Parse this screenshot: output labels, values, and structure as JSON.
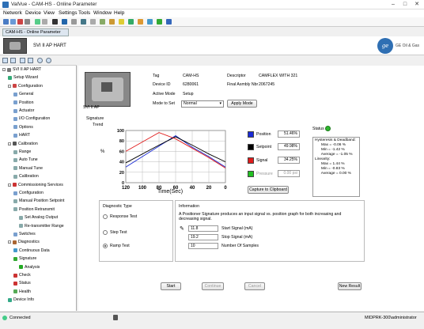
{
  "window": {
    "title": "ValVue - CAM-HS - Online Parameter",
    "controls": [
      "–",
      "□",
      "✕"
    ]
  },
  "menu": [
    "Network",
    "Device",
    "View",
    "Settings",
    "Tools",
    "Window",
    "Help"
  ],
  "doc_tab": "CAM-HS - Online Parameter",
  "header": {
    "device_name": "SVI II AP HART",
    "logo_text": "ge",
    "brand": "GE Oil & Gas"
  },
  "tree": {
    "items": [
      {
        "label": "SVI II AP HART",
        "level": 0,
        "icon": "device-icon"
      },
      {
        "label": "Setup Wizard",
        "level": 1,
        "icon": "wizard-icon"
      },
      {
        "label": "Configuration",
        "level": 1,
        "icon": "config-icon"
      },
      {
        "label": "General",
        "level": 2,
        "icon": "page-icon"
      },
      {
        "label": "Position",
        "level": 2,
        "icon": "page-icon"
      },
      {
        "label": "Actuator",
        "level": 2,
        "icon": "page-icon"
      },
      {
        "label": "I/O Configuration",
        "level": 2,
        "icon": "page-icon"
      },
      {
        "label": "Options",
        "level": 2,
        "icon": "page-icon"
      },
      {
        "label": "HART",
        "level": 2,
        "icon": "page-icon"
      },
      {
        "label": "Calibration",
        "level": 1,
        "icon": "calibration-icon"
      },
      {
        "label": "Range",
        "level": 2,
        "icon": "tool-icon"
      },
      {
        "label": "Auto Tune",
        "level": 2,
        "icon": "tool-icon"
      },
      {
        "label": "Manual Tune",
        "level": 2,
        "icon": "tool-icon"
      },
      {
        "label": "Calibration",
        "level": 2,
        "icon": "tool-icon"
      },
      {
        "label": "Commissioning Services",
        "level": 1,
        "icon": "commissioning-icon"
      },
      {
        "label": "Configuration",
        "level": 2,
        "icon": "page-icon"
      },
      {
        "label": "Manual Position Setpoint",
        "level": 2,
        "icon": "tool-icon"
      },
      {
        "label": "Position Retransmit",
        "level": 2,
        "icon": "tool-icon"
      },
      {
        "label": "Set Analog Output",
        "level": 3,
        "icon": "tool-icon"
      },
      {
        "label": "Re-transmitter Range",
        "level": 3,
        "icon": "tool-icon"
      },
      {
        "label": "Switches",
        "level": 2,
        "icon": "page-icon"
      },
      {
        "label": "Diagnostics",
        "level": 1,
        "icon": "diagnostics-icon"
      },
      {
        "label": "Continuous Data",
        "level": 2,
        "icon": "data-icon"
      },
      {
        "label": "Signature",
        "level": 2,
        "icon": "signature-icon"
      },
      {
        "label": "Analysis",
        "level": 3,
        "icon": "analysis-icon"
      },
      {
        "label": "Check",
        "level": 2,
        "icon": "check-icon"
      },
      {
        "label": "Status",
        "level": 2,
        "icon": "status-icon"
      },
      {
        "label": "Health",
        "level": 2,
        "icon": "health-icon"
      },
      {
        "label": "Device Info",
        "level": 1,
        "icon": "info-icon"
      }
    ]
  },
  "device": {
    "image_caption": "SVI II AP",
    "tag_label": "Tag",
    "tag_value": "CAM-HS",
    "descriptor_label": "Descriptor",
    "descriptor_value": "CAMFLEX WITH 321",
    "device_id_label": "Device ID",
    "device_id_value": "6280061",
    "final_assembly_label": "Final Asmbly Nbr",
    "final_assembly_value": "2067245",
    "active_mode_label": "Active Mode",
    "active_mode_value": "Setup",
    "mode_to_set_label": "Mode to Set",
    "mode_to_set_value": "Normal",
    "apply_mode_button": "Apply Mode"
  },
  "signature": {
    "section_label": "Signature",
    "trend_label": "Trend",
    "legend": [
      {
        "name": "Position",
        "value": "51.46%",
        "color": "#1a2bd6"
      },
      {
        "name": "Setpoint",
        "value": "49.98%",
        "color": "#000000"
      },
      {
        "name": "Signal",
        "value": "34.25%",
        "color": "#e01b1b"
      },
      {
        "name": "Pressure",
        "value": "0.00 psi",
        "color": "#22c022"
      }
    ],
    "capture_button": "Capture to Clipboard"
  },
  "chart_data": {
    "type": "line",
    "ylabel": "%",
    "xlabel": "Time(Sec)",
    "xlim": [
      120,
      0
    ],
    "ylim": [
      0,
      100
    ],
    "xticks": [
      120,
      100,
      80,
      60,
      40,
      20,
      0
    ],
    "yticks": [
      0,
      20,
      40,
      60,
      80,
      100
    ],
    "grid": true,
    "series": [
      {
        "name": "Position",
        "color": "#1a2bd6",
        "x": [
          120,
          100,
          80,
          60,
          40,
          20,
          0
        ],
        "y": [
          30,
          50,
          70,
          90,
          68,
          50,
          30
        ]
      },
      {
        "name": "Setpoint",
        "color": "#000000",
        "x": [
          120,
          100,
          80,
          60,
          40,
          20,
          0
        ],
        "y": [
          38,
          55,
          72,
          88,
          72,
          55,
          40
        ]
      },
      {
        "name": "Signal",
        "color": "#e01b1b",
        "x": [
          120,
          100,
          80,
          60,
          40,
          20,
          0
        ],
        "y": [
          60,
          78,
          96,
          84,
          66,
          48,
          28
        ]
      }
    ]
  },
  "status": {
    "label": "Status",
    "box_text": "Hysteresis & Deadband:\n      Max = -0.06 %\n      Min = -1.42 %\n      Average = -1.05 %\nLinearity:\n      Max = 1.44 %\n      Min = -0.83 %\n      Average = 0.00 %"
  },
  "diagnostic_type": {
    "label": "Diagnostic Type",
    "options": [
      {
        "label": "Response Test",
        "selected": false
      },
      {
        "label": "Step Test",
        "selected": false
      },
      {
        "label": "Ramp Test",
        "selected": true
      }
    ]
  },
  "information": {
    "label": "Information",
    "text": "A Positioner Signature produces an input signal vs. position graph for both increasing and decreasing signal.",
    "fields": [
      {
        "value": "11.8",
        "label": "Start Signal (mA)"
      },
      {
        "value": "19.2",
        "label": "Stop Signal (mA)"
      },
      {
        "value": "10",
        "label": "Number Of Samples"
      }
    ]
  },
  "actions": {
    "start": "Start",
    "continue": "Continue",
    "cancel": "Cancel",
    "new_result": "New Result"
  },
  "statusbar": {
    "connection": "Connected",
    "user": "MIDPRK-300\\administrator"
  }
}
